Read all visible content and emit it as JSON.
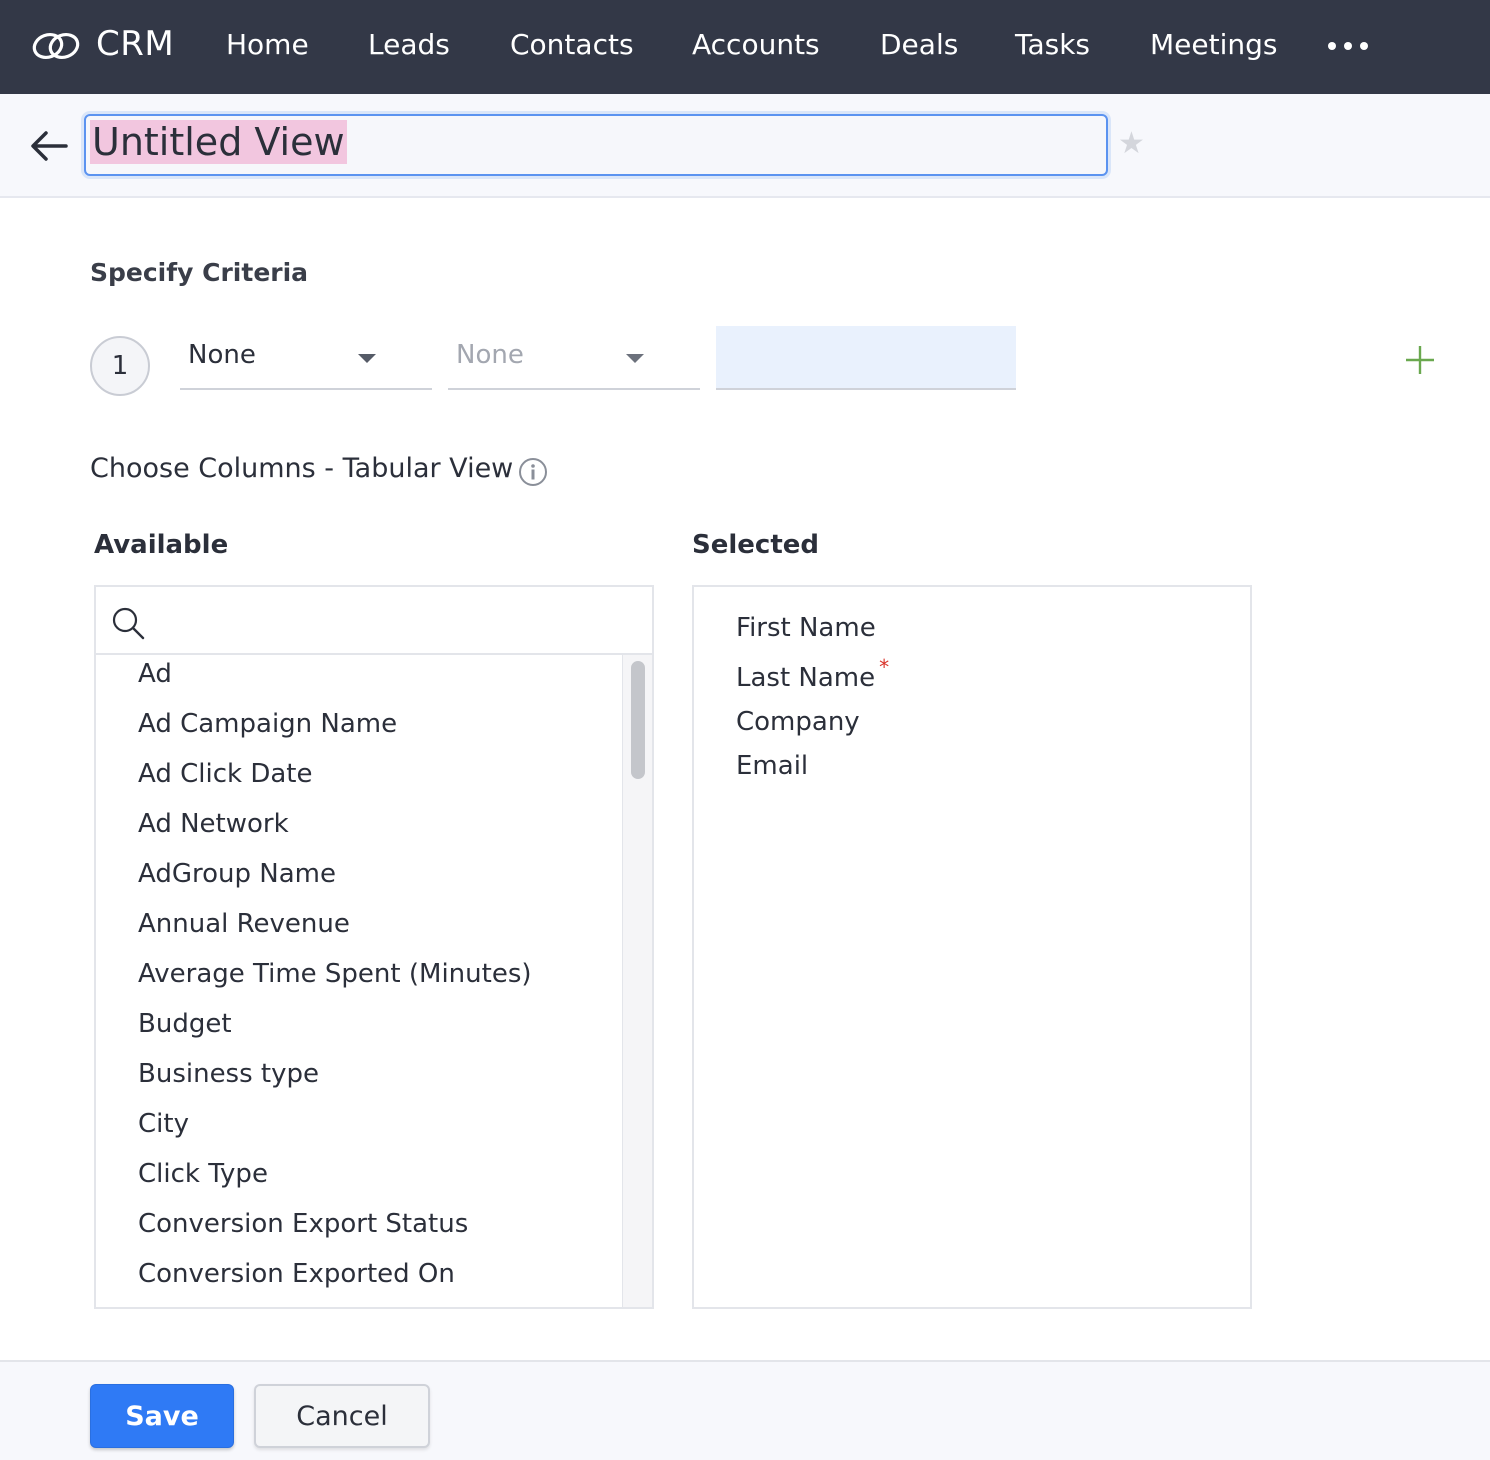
{
  "nav": {
    "brand": "CRM",
    "items": [
      "Home",
      "Leads",
      "Contacts",
      "Accounts",
      "Deals",
      "Tasks",
      "Meetings"
    ]
  },
  "header": {
    "view_name": "Untitled View"
  },
  "criteria": {
    "title": "Specify Criteria",
    "rows": [
      {
        "number": "1",
        "field": "None",
        "operator": "None",
        "value": ""
      }
    ]
  },
  "columns": {
    "title": "Choose Columns - Tabular View",
    "available_label": "Available",
    "selected_label": "Selected",
    "search_value": "",
    "available": [
      "Ad",
      "Ad Campaign Name",
      "Ad Click Date",
      "Ad Network",
      "AdGroup Name",
      "Annual Revenue",
      "Average Time Spent (Minutes)",
      "Budget",
      "Business type",
      "City",
      "Click Type",
      "Conversion Export Status",
      "Conversion Exported On"
    ],
    "selected": [
      {
        "label": "First Name",
        "required": false
      },
      {
        "label": "Last Name",
        "required": true
      },
      {
        "label": "Company",
        "required": false
      },
      {
        "label": "Email",
        "required": false
      }
    ],
    "required_mark": "*"
  },
  "footer": {
    "save_label": "Save",
    "cancel_label": "Cancel"
  },
  "colors": {
    "topbar": "#333847",
    "primary": "#2f7af5",
    "required": "#d9342b",
    "add": "#6aa84f"
  }
}
